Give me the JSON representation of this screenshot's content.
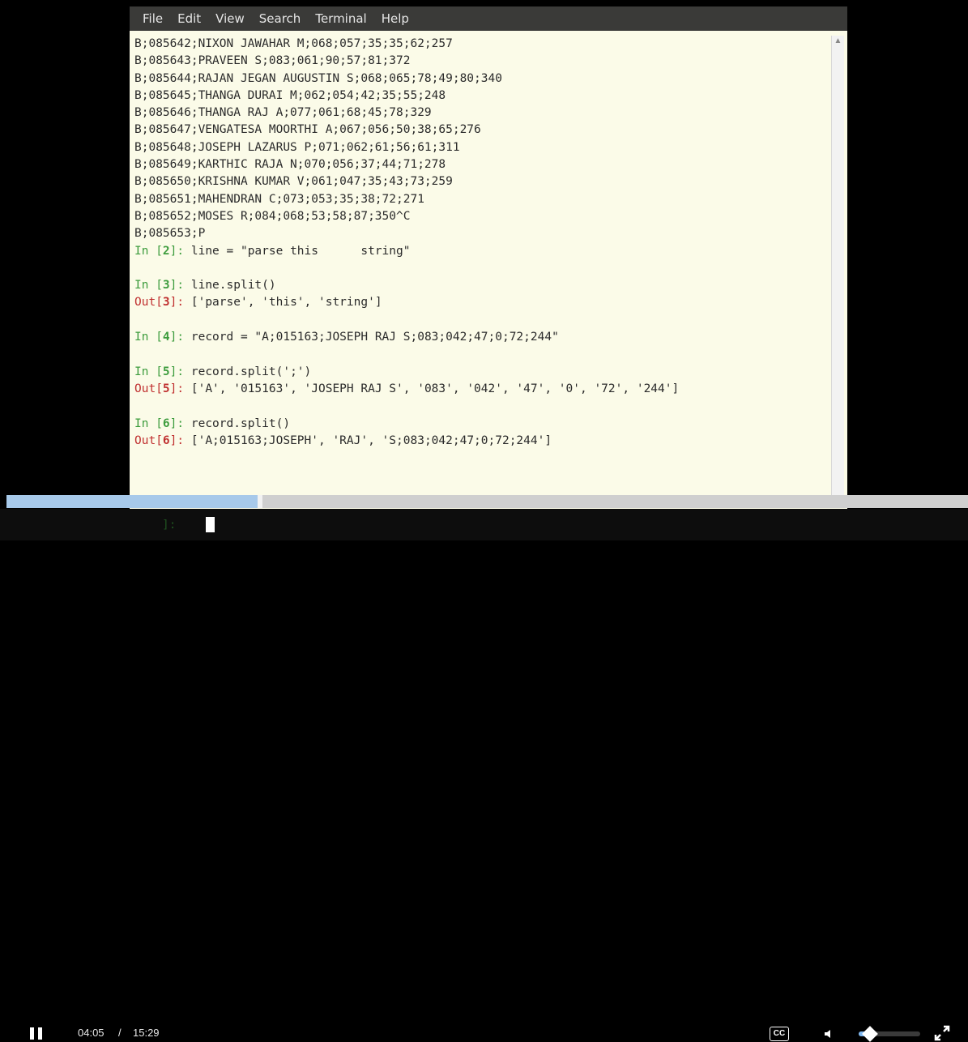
{
  "menu": [
    "File",
    "Edit",
    "View",
    "Search",
    "Terminal",
    "Help"
  ],
  "lines": [
    {
      "type": "text",
      "text": "B;085642;NIXON JAWAHAR M;068;057;35;35;62;257"
    },
    {
      "type": "text",
      "text": "B;085643;PRAVEEN S;083;061;90;57;81;372"
    },
    {
      "type": "text",
      "text": "B;085644;RAJAN JEGAN AUGUSTIN S;068;065;78;49;80;340"
    },
    {
      "type": "text",
      "text": "B;085645;THANGA DURAI M;062;054;42;35;55;248"
    },
    {
      "type": "text",
      "text": "B;085646;THANGA RAJ A;077;061;68;45;78;329"
    },
    {
      "type": "text",
      "text": "B;085647;VENGATESA MOORTHI A;067;056;50;38;65;276"
    },
    {
      "type": "text",
      "text": "B;085648;JOSEPH LAZARUS P;071;062;61;56;61;311"
    },
    {
      "type": "text",
      "text": "B;085649;KARTHIC RAJA N;070;056;37;44;71;278"
    },
    {
      "type": "text",
      "text": "B;085650;KRISHNA KUMAR V;061;047;35;43;73;259"
    },
    {
      "type": "text",
      "text": "B;085651;MAHENDRAN C;073;053;35;38;72;271"
    },
    {
      "type": "text",
      "text": "B;085652;MOSES R;084;068;53;58;87;350^C"
    },
    {
      "type": "text",
      "text": "B;085653;P"
    },
    {
      "type": "in",
      "n": "2",
      "code": "line = \"parse this      string\""
    },
    {
      "type": "blank"
    },
    {
      "type": "in",
      "n": "3",
      "code": "line.split()"
    },
    {
      "type": "out",
      "n": "3",
      "code": "['parse', 'this', 'string']"
    },
    {
      "type": "blank"
    },
    {
      "type": "in",
      "n": "4",
      "code": "record = \"A;015163;JOSEPH RAJ S;083;042;47;0;72;244\""
    },
    {
      "type": "blank"
    },
    {
      "type": "in",
      "n": "5",
      "code": "record.split(';')"
    },
    {
      "type": "out",
      "n": "5",
      "code": "['A', '015163', 'JOSEPH RAJ S', '083', '042', '47', '0', '72', '244']"
    },
    {
      "type": "blank"
    },
    {
      "type": "in",
      "n": "6",
      "code": "record.split()"
    },
    {
      "type": "out",
      "n": "6",
      "code": "['A;015163;JOSEPH', 'RAJ', 'S;083;042;47;0;72;244']"
    }
  ],
  "player": {
    "time_current": "04:05",
    "time_separator": "/",
    "time_total": "15:29",
    "progress": 0.264,
    "volume": 0.18,
    "cc_label": "CC"
  }
}
